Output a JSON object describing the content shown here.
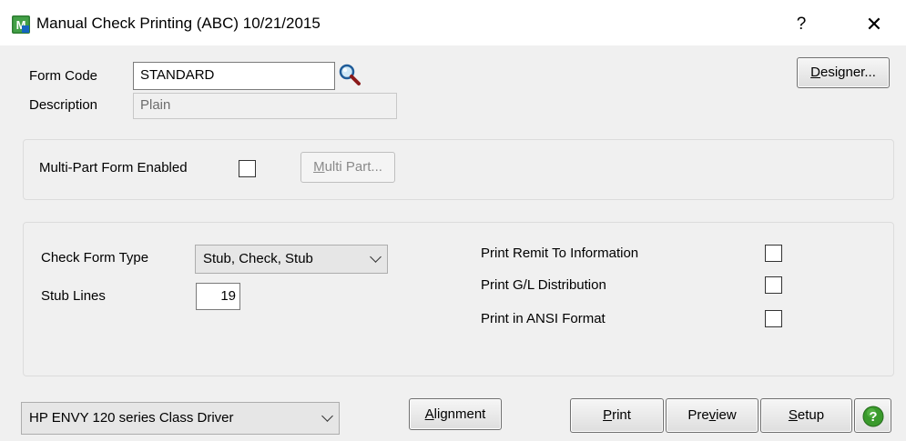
{
  "window": {
    "title": "Manual Check Printing (ABC) 10/21/2015",
    "help_glyph": "?",
    "close_glyph": "✕",
    "app_icon": "sage-mas-icon"
  },
  "form": {
    "form_code_label": "Form Code",
    "form_code_value": "STANDARD",
    "description_label": "Description",
    "description_value": "Plain",
    "designer_button": {
      "mnemonic": "D",
      "rest": "esigner..."
    }
  },
  "multipart": {
    "label": "Multi-Part Form Enabled",
    "checked": false,
    "button": {
      "mnemonic": "M",
      "rest": "ulti Part..."
    }
  },
  "options": {
    "check_form_type_label": "Check Form Type",
    "check_form_type_value": "Stub, Check, Stub",
    "stub_lines_label": "Stub Lines",
    "stub_lines_value": "19",
    "print_remit_label": "Print Remit To Information",
    "print_gl_label": "Print G/L Distribution",
    "print_ansi_label": "Print in ANSI Format",
    "print_remit_checked": false,
    "print_gl_checked": false,
    "print_ansi_checked": false
  },
  "footer": {
    "printer_value": "HP ENVY 120 series Class Driver",
    "alignment_button": {
      "mnemonic": "A",
      "rest": "lignment"
    },
    "print_button": {
      "mnemonic": "P",
      "rest": "rint"
    },
    "preview_button": {
      "pre": "Pre",
      "mnemonic": "v",
      "rest": "iew"
    },
    "setup_button": {
      "mnemonic": "S",
      "rest": "etup"
    },
    "help_icon": "help-circle-icon"
  },
  "colors": {
    "help_green": "#3a9a2c",
    "field_border": "#7a7a7a",
    "window_bg": "#f0f0f0"
  }
}
